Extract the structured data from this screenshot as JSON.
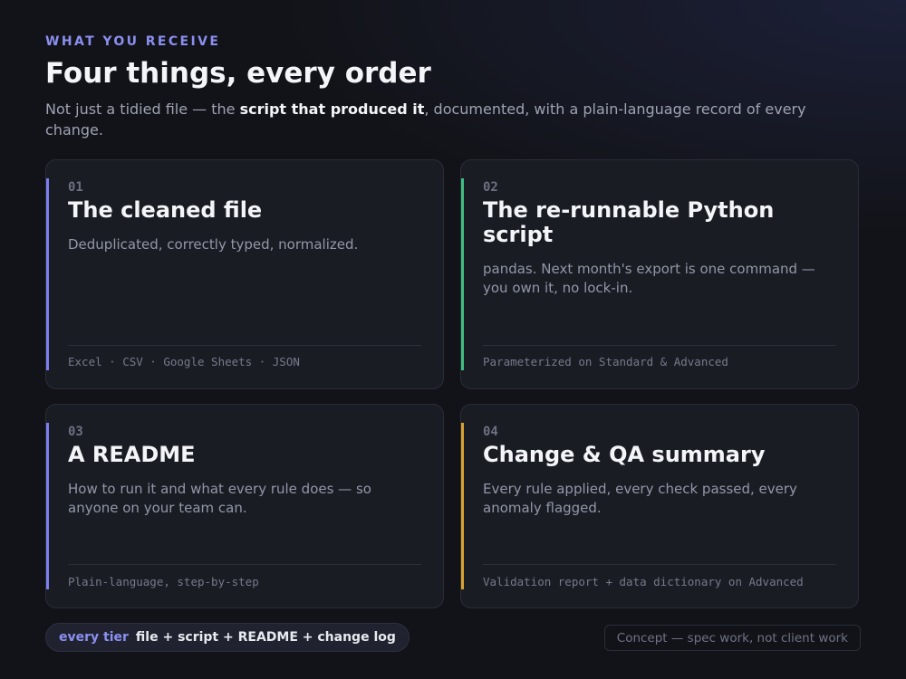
{
  "header": {
    "eyebrow": "WHAT YOU RECEIVE",
    "title": "Four things, every order",
    "subtitle_before": "Not just a tidied file — the ",
    "subtitle_strong": "script that produced it",
    "subtitle_after": ", documented, with a plain-language record of every change."
  },
  "cards": [
    {
      "number": "01",
      "title": "The cleaned file",
      "description": "Deduplicated, correctly typed, normalized.",
      "footer": "Excel · CSV · Google Sheets · JSON",
      "accent_color": "#7b7ff0"
    },
    {
      "number": "02",
      "title": "The re-runnable Python script",
      "description": "pandas. Next month's export is one command — you own it, no lock-in.",
      "footer": "Parameterized on Standard & Advanced",
      "accent_color": "#3fbf7f"
    },
    {
      "number": "03",
      "title": "A README",
      "description": "How to run it and what every rule does — so anyone on your team can.",
      "footer": "Plain-language, step-by-step",
      "accent_color": "#7b7ff0"
    },
    {
      "number": "04",
      "title": "Change & QA summary",
      "description": "Every rule applied, every check passed, every anomaly flagged.",
      "footer": "Validation report + data dictionary on Advanced",
      "accent_color": "#d9a22e"
    }
  ],
  "footer": {
    "tier_label": "every tier",
    "tier_text": "file + script + README + change log",
    "concept_note": "Concept — spec work, not client work"
  }
}
